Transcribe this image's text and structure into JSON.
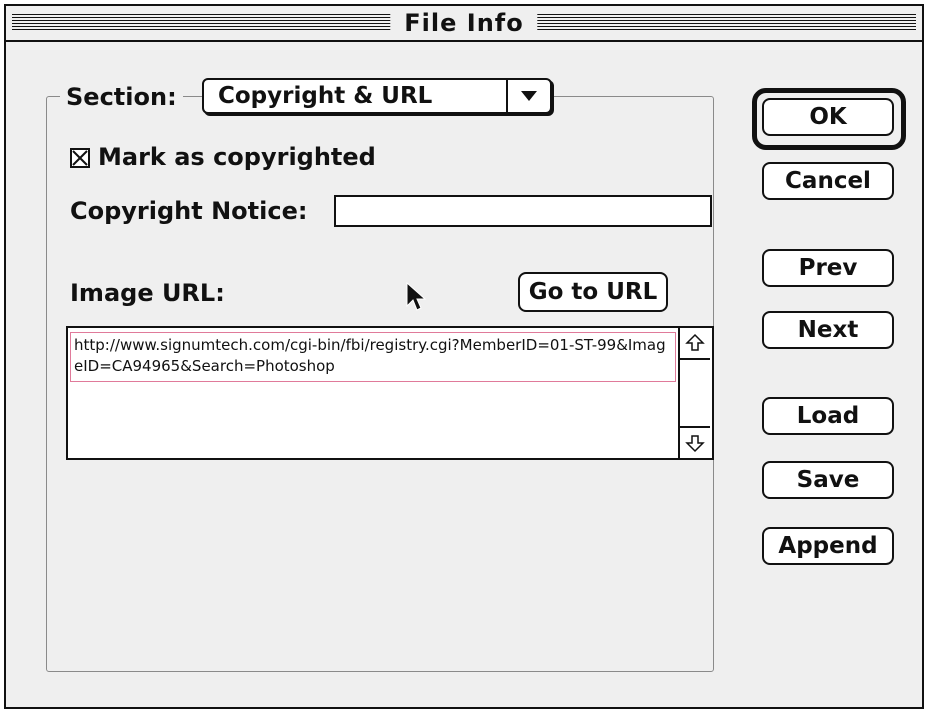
{
  "window": {
    "title": "File Info"
  },
  "section": {
    "label": "Section:",
    "selected": "Copyright & URL"
  },
  "copyright": {
    "mark_label": "Mark as copyrighted",
    "mark_checked": true,
    "notice_label": "Copyright Notice:",
    "notice_value": ""
  },
  "url": {
    "label": "Image URL:",
    "goto_label": "Go to URL",
    "value": "http://www.signumtech.com/cgi-bin/fbi/registry.cgi?MemberID=01-ST-99&ImageID=CA94965&Search=Photoshop"
  },
  "buttons": {
    "ok": "OK",
    "cancel": "Cancel",
    "prev": "Prev",
    "next": "Next",
    "load": "Load",
    "save": "Save",
    "append": "Append"
  }
}
